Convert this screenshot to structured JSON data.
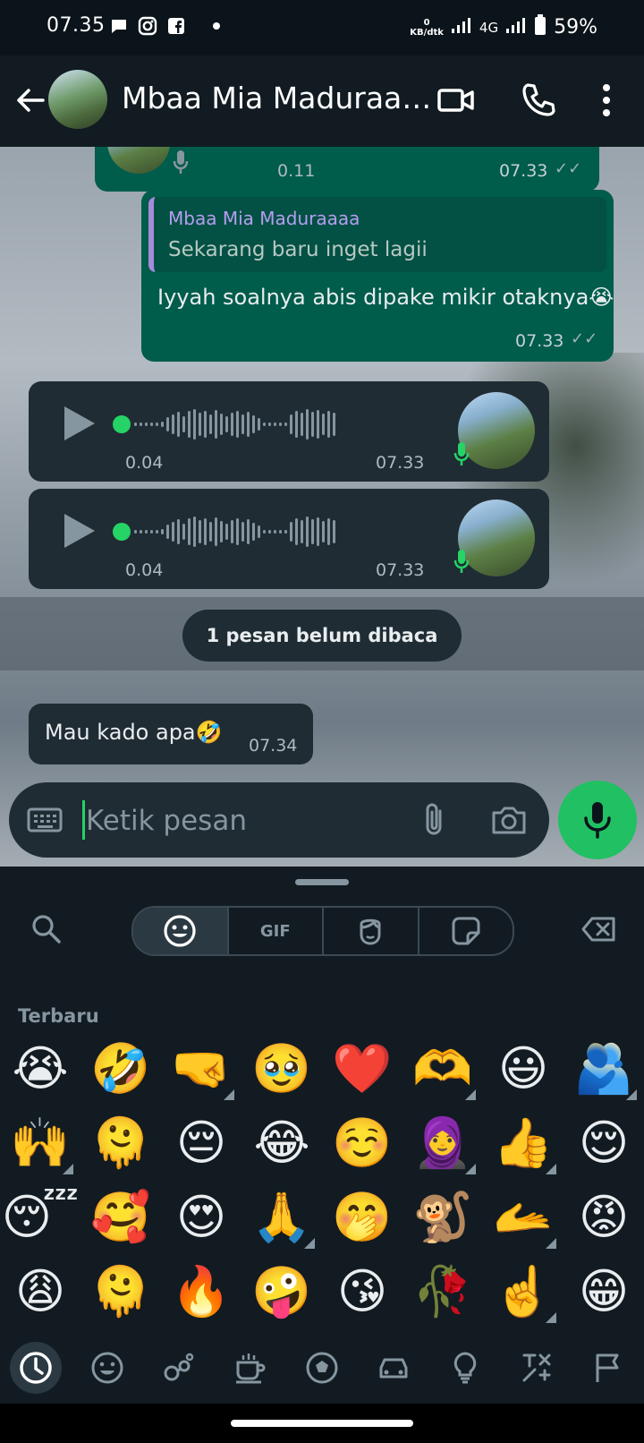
{
  "status_bar": {
    "time": "07.35",
    "net_speed_value": "0",
    "net_speed_unit": "KB/dtk",
    "network": "4G",
    "battery": "59%"
  },
  "header": {
    "contact_name": "Mbaa Mia Maduraa…",
    "icons": [
      "back-arrow-icon",
      "video-call-icon",
      "phone-call-icon",
      "more-vert-icon"
    ]
  },
  "messages": [
    {
      "type": "voice_out_partial",
      "duration": "0.11",
      "time": "07.33"
    },
    {
      "type": "reply_out",
      "quote_author": "Mbaa Mia Maduraaaa",
      "quote_text": "Sekarang baru inget lagii",
      "text": "Iyyah soalnya abis dipake mikir otaknya😭",
      "time": "07.33"
    },
    {
      "type": "voice_in",
      "duration": "0.04",
      "time": "07.33"
    },
    {
      "type": "voice_in",
      "duration": "0.04",
      "time": "07.33"
    },
    {
      "type": "text_in",
      "text": "Mau kado apa🤣",
      "time": "07.34"
    }
  ],
  "unread_divider": "1 pesan belum dibaca",
  "composer": {
    "placeholder": "Ketik pesan"
  },
  "emoji_panel": {
    "tabs": [
      "emoji",
      "GIF",
      "avatar",
      "sticker"
    ],
    "gif_label": "GIF",
    "section_title": "Terbaru",
    "recent": [
      "😭",
      "🤣",
      "🤜",
      "🥹",
      "❤️",
      "🫶",
      "😃",
      "🫂",
      "🙌",
      "🫠",
      "😔",
      "😂",
      "☺️",
      "🧕",
      "👍",
      "😌",
      "😴",
      "🥰",
      "😍",
      "🙏",
      "🤭",
      "🐒",
      "🫴",
      "😡",
      "😩",
      "🫠",
      "🔥",
      "🤪",
      "😘",
      "🥀",
      "☝️",
      "😁"
    ],
    "variant_marks": [
      2,
      5,
      7,
      8,
      13,
      14,
      19,
      22,
      30
    ],
    "categories": [
      "recent-icon",
      "smiley-icon",
      "animals-icon",
      "food-icon",
      "activity-icon",
      "travel-icon",
      "objects-icon",
      "symbols-icon",
      "flags-icon"
    ]
  },
  "colors": {
    "accent_green": "#25d366",
    "outgoing_bubble": "#005c4b",
    "incoming_bubble": "#202c33",
    "header_bg": "#111b21"
  }
}
